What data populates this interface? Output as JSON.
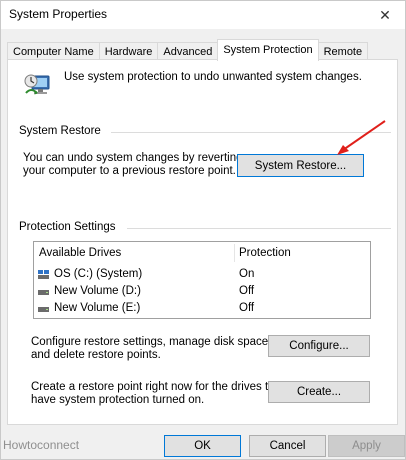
{
  "window": {
    "title": "System Properties",
    "close_glyph": "✕"
  },
  "tabs": [
    {
      "label": "Computer Name",
      "active": false
    },
    {
      "label": "Hardware",
      "active": false
    },
    {
      "label": "Advanced",
      "active": false
    },
    {
      "label": "System Protection",
      "active": true
    },
    {
      "label": "Remote",
      "active": false
    }
  ],
  "intro": {
    "text": "Use system protection to undo unwanted system changes.",
    "icon": "computer-shield-icon"
  },
  "system_restore": {
    "group_label": "System Restore",
    "description_line1": "You can undo system changes by reverting",
    "description_line2": "your computer to a previous restore point.",
    "button_label": "System Restore..."
  },
  "protection_settings": {
    "group_label": "Protection Settings",
    "columns": [
      "Available Drives",
      "Protection"
    ],
    "drives": [
      {
        "name": "OS (C:) (System)",
        "protection": "On",
        "icon": "system-drive-icon"
      },
      {
        "name": "New Volume (D:)",
        "protection": "Off",
        "icon": "drive-icon"
      },
      {
        "name": "New Volume (E:)",
        "protection": "Off",
        "icon": "drive-icon"
      }
    ],
    "configure_text_line1": "Configure restore settings, manage disk space,",
    "configure_text_line2": "and delete restore points.",
    "configure_button": "Configure...",
    "create_text_line1": "Create a restore point right now for the drives that",
    "create_text_line2": "have system protection turned on.",
    "create_button": "Create..."
  },
  "footer": {
    "ok": "OK",
    "cancel": "Cancel",
    "apply": "Apply"
  },
  "watermark": "Howtoconnect",
  "colors": {
    "focus_blue": "#0078d7",
    "annotation_red": "#e0201b"
  }
}
